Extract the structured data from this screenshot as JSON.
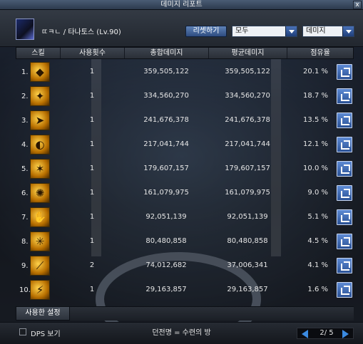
{
  "window": {
    "title": "데미지 리포트",
    "close": "x"
  },
  "header": {
    "character": "ㄸㅋㄴ / 타나토스 (Lv.90)",
    "reset_label": "리셋하기",
    "filter_1": "모두",
    "filter_2": "데미지"
  },
  "columns": [
    "스킬",
    "사용횟수",
    "총합데미지",
    "평균데미지",
    "점유율"
  ],
  "rows": [
    {
      "rank": "1.",
      "uses": "1",
      "total": "359,505,122",
      "avg": "359,505,122",
      "share": "20.1 %",
      "glyph": "◆"
    },
    {
      "rank": "2.",
      "uses": "1",
      "total": "334,560,270",
      "avg": "334,560,270",
      "share": "18.7 %",
      "glyph": "✦"
    },
    {
      "rank": "3.",
      "uses": "1",
      "total": "241,676,378",
      "avg": "241,676,378",
      "share": "13.5 %",
      "glyph": "➤"
    },
    {
      "rank": "4.",
      "uses": "1",
      "total": "217,041,744",
      "avg": "217,041,744",
      "share": "12.1 %",
      "glyph": "◐"
    },
    {
      "rank": "5.",
      "uses": "1",
      "total": "179,607,157",
      "avg": "179,607,157",
      "share": "10.0 %",
      "glyph": "✶"
    },
    {
      "rank": "6.",
      "uses": "1",
      "total": "161,079,975",
      "avg": "161,079,975",
      "share": "9.0 %",
      "glyph": "✺"
    },
    {
      "rank": "7.",
      "uses": "1",
      "total": "92,051,139",
      "avg": "92,051,139",
      "share": "5.1 %",
      "glyph": "✋"
    },
    {
      "rank": "8.",
      "uses": "1",
      "total": "80,480,858",
      "avg": "80,480,858",
      "share": "4.5 %",
      "glyph": "✳"
    },
    {
      "rank": "9.",
      "uses": "2",
      "total": "74,012,682",
      "avg": "37,006,341",
      "share": "4.1 %",
      "glyph": "⟋"
    },
    {
      "rank": "10.",
      "uses": "1",
      "total": "29,163,857",
      "avg": "29,163,857",
      "share": "1.6 %",
      "glyph": "⚡"
    }
  ],
  "footer": {
    "used_tab": "사용한 설정",
    "dps_label": "DPS 보기",
    "dungeon": "던전명 = 수련의 방",
    "page": "2/ 5"
  },
  "colors": {
    "accent": "#3b8ae0",
    "header_bg": "#2a2f37",
    "skill_gold": "#ffd24a"
  }
}
